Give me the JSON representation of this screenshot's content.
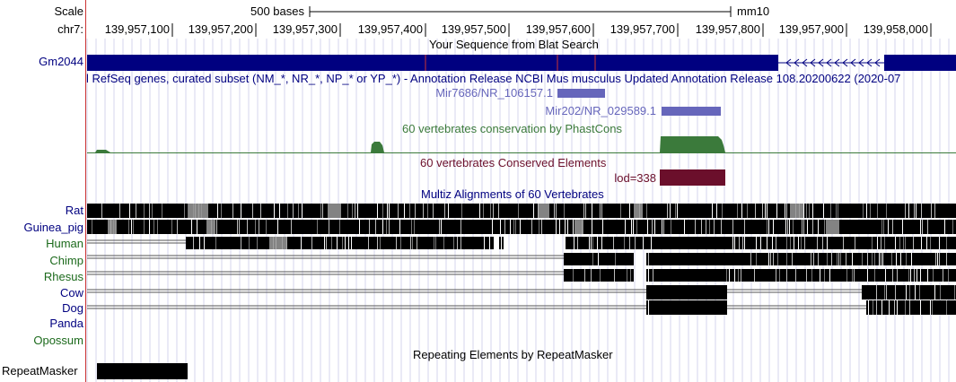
{
  "ruler": {
    "scale_label": "Scale",
    "chrom_label": "chr7:",
    "scale_text": "500 bases",
    "assembly": "mm10",
    "ticks": [
      "139,957,100",
      "139,957,200",
      "139,957,300",
      "139,957,400",
      "139,957,500",
      "139,957,600",
      "139,957,700",
      "139,957,800",
      "139,957,900",
      "139,958,000"
    ]
  },
  "tracks": {
    "blat_title": "Your Sequence from Blat Search",
    "blat_item": "Gm2044",
    "refseq_title": "l RefSeq genes, curated subset (NM_*, NR_*, NP_* or YP_*) - Annotation Release NCBI Mus musculus Updated Annotation Release 108.20200622 (2020-07",
    "refseq_items": [
      "Mir7686/NR_106157.1",
      "Mir202/NR_029589.1"
    ],
    "cons_title": "60 vertebrates conservation by PhastCons",
    "elements_title": "60 vertebrates Conserved Elements",
    "element_item": "lod=338",
    "multiz_title": "Multiz Alignments of 60 Vertebrates",
    "species": [
      "Rat",
      "Guinea_pig",
      "Human",
      "Chimp",
      "Rhesus",
      "Cow",
      "Dog",
      "Panda",
      "Opossum"
    ],
    "repeat_title": "Repeating Elements by RepeatMasker",
    "repeat_label": "RepeatMasker"
  },
  "colors": {
    "navy": "#000080",
    "refseq": "#6666bb",
    "cons": "#3b7a3b",
    "element": "#6b0f2b",
    "species_green": "#1c6a1c",
    "ruler_red": "#cc3333"
  }
}
